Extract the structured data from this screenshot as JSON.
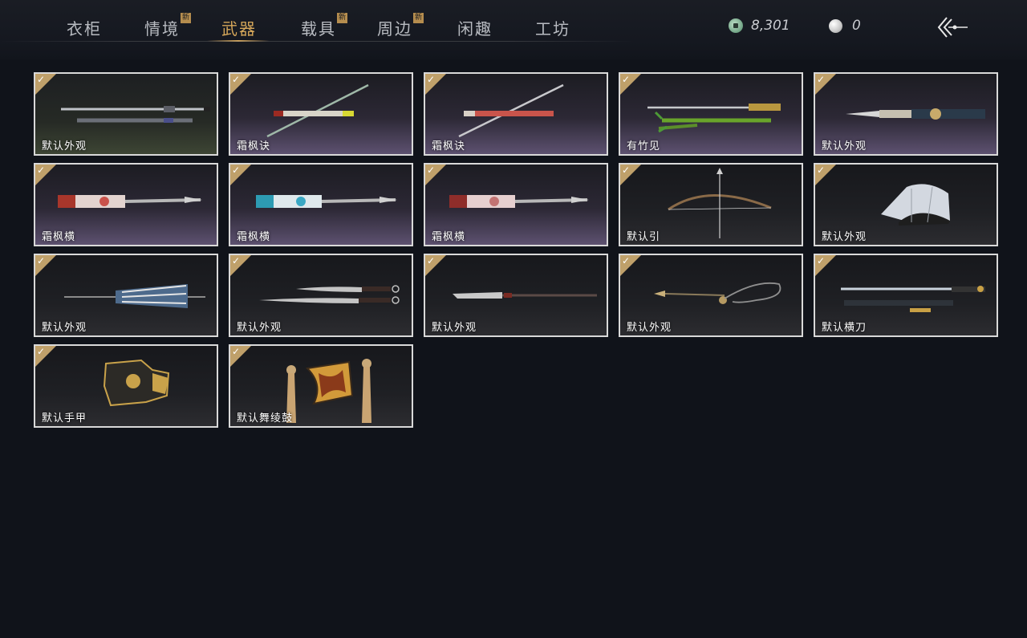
{
  "nav": {
    "tabs": [
      {
        "label": "衣柜",
        "new": false
      },
      {
        "label": "情境",
        "new": true
      },
      {
        "label": "武器",
        "new": false,
        "active": true
      },
      {
        "label": "载具",
        "new": true
      },
      {
        "label": "周边",
        "new": true
      },
      {
        "label": "闲趣",
        "new": false
      },
      {
        "label": "工坊",
        "new": false
      }
    ],
    "new_badge": "新"
  },
  "currency": {
    "jade_coin": {
      "icon": "jade-coin-icon",
      "value": "8,301"
    },
    "pearl": {
      "icon": "pearl-icon",
      "value": "0"
    }
  },
  "back_button": {
    "icon": "back-arrow-icon"
  },
  "colors": {
    "accent": "#d6a75a",
    "badge": "#b58d4e",
    "check": "#bfa06a",
    "background": "#10131a"
  },
  "items": [
    {
      "label": "默认外观",
      "icon": "sword-icon",
      "equipped": true
    },
    {
      "label": "霜枫诀",
      "icon": "sword-icon",
      "equipped": true
    },
    {
      "label": "霜枫诀",
      "icon": "sword-icon",
      "equipped": true
    },
    {
      "label": "有竹见",
      "icon": "bamboo-sword-icon",
      "equipped": true
    },
    {
      "label": "默认外观",
      "icon": "spear-icon",
      "equipped": true
    },
    {
      "label": "霜枫横",
      "icon": "spear-icon",
      "equipped": true
    },
    {
      "label": "霜枫横",
      "icon": "spear-icon",
      "equipped": true
    },
    {
      "label": "霜枫横",
      "icon": "spear-icon",
      "equipped": true
    },
    {
      "label": "默认引",
      "icon": "bow-icon",
      "equipped": true
    },
    {
      "label": "默认外观",
      "icon": "fan-icon",
      "equipped": true
    },
    {
      "label": "默认外观",
      "icon": "umbrella-icon",
      "equipped": true
    },
    {
      "label": "默认外观",
      "icon": "dual-blades-icon",
      "equipped": true
    },
    {
      "label": "默认外观",
      "icon": "glaive-icon",
      "equipped": true
    },
    {
      "label": "默认外观",
      "icon": "rope-dart-icon",
      "equipped": true
    },
    {
      "label": "默认横刀",
      "icon": "saber-icon",
      "equipped": true
    },
    {
      "label": "默认手甲",
      "icon": "gauntlet-icon",
      "equipped": true
    },
    {
      "label": "默认舞绫鼓",
      "icon": "drum-icon",
      "equipped": true
    }
  ],
  "check_mark": "✓"
}
